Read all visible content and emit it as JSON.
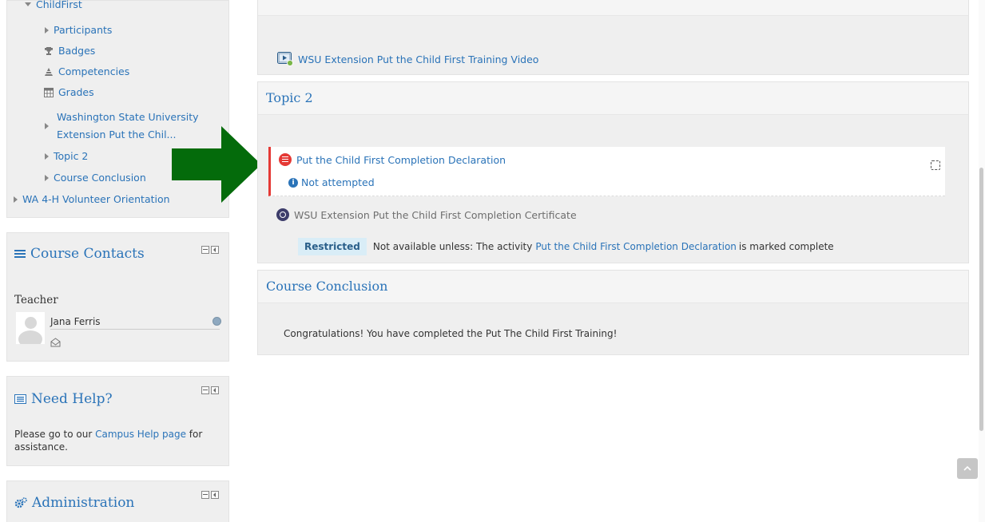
{
  "nav": {
    "course_title": "ChildFirst",
    "items": [
      {
        "label": "Participants"
      },
      {
        "label": "Badges"
      },
      {
        "label": "Competencies"
      },
      {
        "label": "Grades"
      },
      {
        "label_line1": "Washington State University",
        "label_line2": "Extension Put the Chil..."
      },
      {
        "label": "Topic 2"
      },
      {
        "label": "Course Conclusion"
      },
      {
        "label": "WA 4-H Volunteer Orientation"
      }
    ]
  },
  "contacts": {
    "title": "Course Contacts",
    "role": "Teacher",
    "name": "Jana Ferris"
  },
  "help": {
    "title": "Need Help?",
    "text_before": "Please go to our ",
    "link": "Campus Help page",
    "text_after": " for",
    "text_line2": "assistance."
  },
  "admin": {
    "title": "Administration"
  },
  "section1": {
    "video_link": "WSU Extension Put the Child First Training Video"
  },
  "topic2": {
    "title": "Topic 2",
    "activity1": {
      "label": "Put the Child First Completion Declaration",
      "status": "Not attempted"
    },
    "activity2": {
      "label": "WSU Extension Put the Child First Completion Certificate",
      "restricted_badge": "Restricted",
      "restriction_text": "Not available unless: The activity ",
      "restriction_link": "Put the Child First Completion Declaration",
      "restriction_tail": " is marked complete"
    }
  },
  "conclusion": {
    "title": "Course Conclusion",
    "text": "Congratulations! You have completed the Put The Child First Training!"
  },
  "colors": {
    "link": "#2a73b8",
    "arrow": "#046b0b",
    "danger": "#e53935",
    "restricted_bg": "#d9edf7"
  }
}
